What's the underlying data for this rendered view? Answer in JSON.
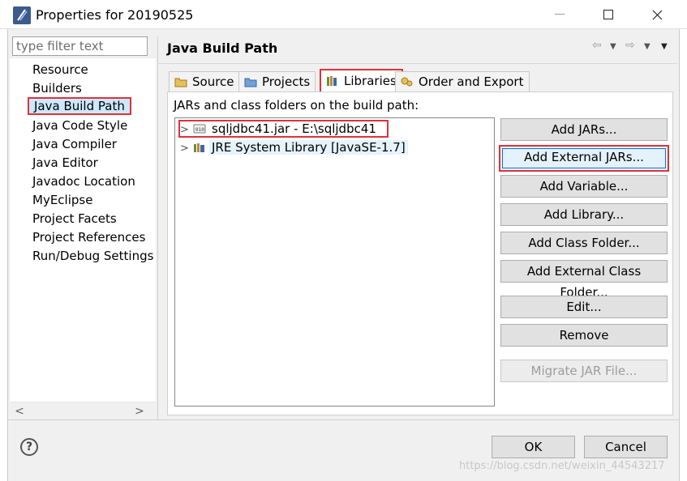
{
  "window": {
    "title": "Properties for 20190525"
  },
  "filter": {
    "placeholder": "type filter text"
  },
  "nav": {
    "items": [
      {
        "label": "Resource"
      },
      {
        "label": "Builders"
      },
      {
        "label": "Java Build Path",
        "selected": true
      },
      {
        "label": "Java Code Style"
      },
      {
        "label": "Java Compiler"
      },
      {
        "label": "Java Editor"
      },
      {
        "label": "Javadoc Location"
      },
      {
        "label": "MyEclipse"
      },
      {
        "label": "Project Facets"
      },
      {
        "label": "Project References"
      },
      {
        "label": "Run/Debug Settings"
      }
    ]
  },
  "page": {
    "title": "Java Build Path"
  },
  "tabs": [
    {
      "label": "Source",
      "icon": "source-folder-icon"
    },
    {
      "label": "Projects",
      "icon": "projects-icon"
    },
    {
      "label": "Libraries",
      "icon": "libraries-icon",
      "active": true
    },
    {
      "label": "Order and Export",
      "icon": "order-export-icon"
    }
  ],
  "libraries": {
    "section_label": "JARs and class folders on the build path:",
    "entries": [
      {
        "label": "sqljdbc41.jar - E:\\sqljdbc41",
        "icon": "jar-icon"
      },
      {
        "label": "JRE System Library [JavaSE-1.7]",
        "icon": "library-icon"
      }
    ],
    "buttons": {
      "add_jars": "Add JARs...",
      "add_external_jars": "Add External JARs...",
      "add_variable": "Add Variable...",
      "add_library": "Add Library...",
      "add_class_folder": "Add Class Folder...",
      "add_external_class_folder": "Add External Class Folder...",
      "edit": "Edit...",
      "remove": "Remove",
      "migrate": "Migrate JAR File..."
    }
  },
  "dialog": {
    "ok": "OK",
    "cancel": "Cancel",
    "help": "?"
  },
  "watermark": "https://blog.csdn.net/weixin_44543217",
  "colors": {
    "highlight_red": "#e0313a",
    "selection_blue": "#cce8ff",
    "focus_blue": "#0078d7"
  }
}
